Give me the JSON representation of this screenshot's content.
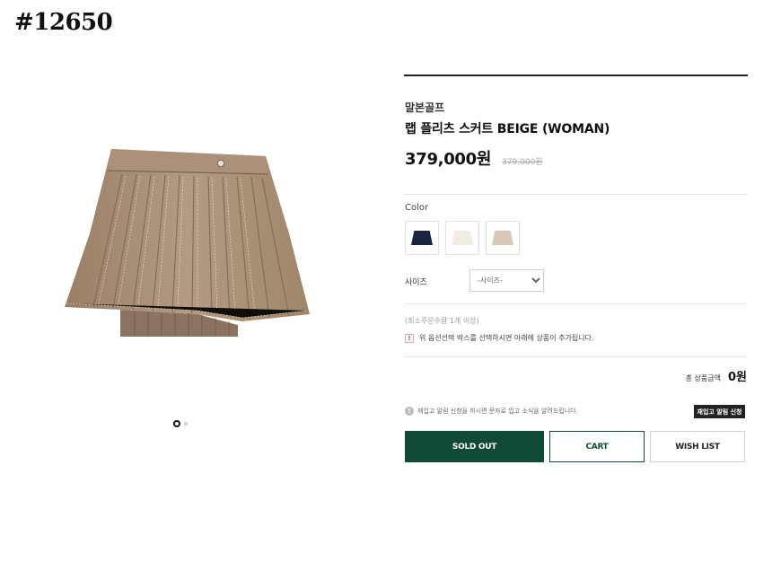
{
  "page_id": "#12650",
  "product": {
    "brand": "말본골프",
    "name": "랩 플리츠 스커트 BEIGE (WOMAN)",
    "price": "379,000원",
    "original_price": "379,000원"
  },
  "options": {
    "color_label": "Color",
    "swatches": [
      {
        "name": "navy",
        "color": "#1a2340"
      },
      {
        "name": "ivory",
        "color": "#f1ece2"
      },
      {
        "name": "beige",
        "color": "#d9c8b3"
      }
    ],
    "size_label": "사이즈",
    "size_selected": "-사이즈-"
  },
  "min_qty": "(최소주문수량 1개 이상)",
  "notice": "위 옵션선택 박스를 선택하시면 아래에 상품이 추가됩니다.",
  "total": {
    "label": "총 상품금액",
    "value": "0원"
  },
  "restock": {
    "notice": "재입고 알림 신청을 하시면 문자로 입고 소식을 알려드립니다.",
    "button": "재입고 알림 신청"
  },
  "buttons": {
    "sold_out": "SOLD OUT",
    "cart": "CART",
    "wish_list": "WISH LIST"
  },
  "colors": {
    "accent": "#0f4a36",
    "skirt": "#a88e74"
  },
  "carousel": {
    "current_slide": 1,
    "total_slides": 2
  }
}
